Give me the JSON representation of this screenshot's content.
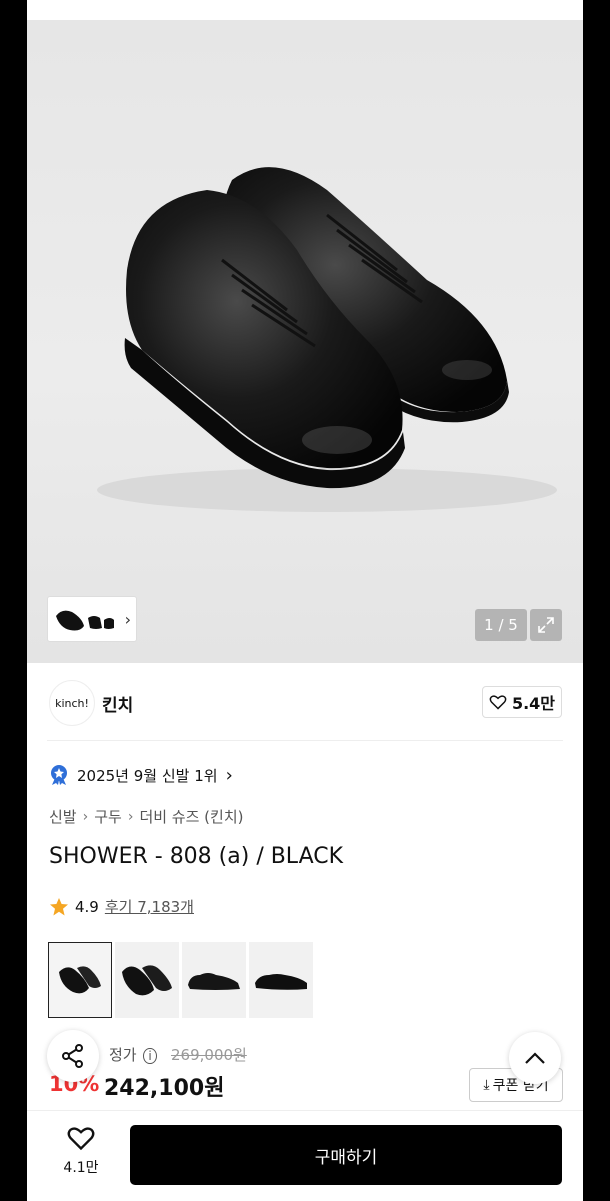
{
  "gallery": {
    "counter": "1 / 5"
  },
  "brand": {
    "logo_text": "kinch!",
    "name": "킨치",
    "likes": "5.4만"
  },
  "ranking": {
    "text": "2025년 9월 신발 1위"
  },
  "breadcrumb": [
    "신발",
    "구두",
    "더비 슈즈 (킨치)"
  ],
  "product": {
    "title": "SHOWER - 808 (a) / BLACK"
  },
  "rating": {
    "score": "4.9",
    "reviews": "후기 7,183개"
  },
  "price": {
    "original_label": "정가",
    "original": "269,000원",
    "discount": "10%",
    "sale": "242,100원",
    "coupon_button": "쿠폰 받기"
  },
  "bottom_bar": {
    "wish_count": "4.1만",
    "buy_label": "구매하기"
  },
  "colors": {
    "accent_red": "#e33333",
    "buy_bg": "#000000",
    "star": "#f5a623"
  }
}
